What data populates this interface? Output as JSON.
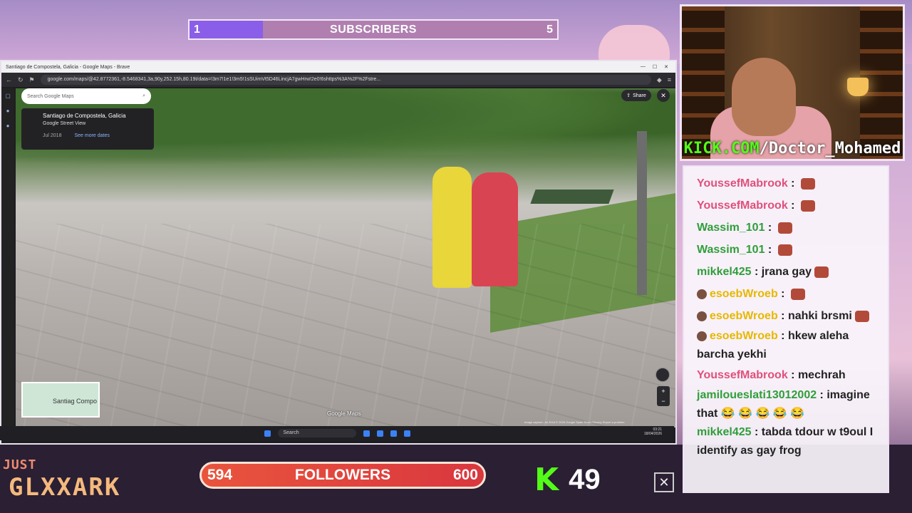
{
  "subscribers": {
    "current": "1",
    "label": "SUBSCRIBERS",
    "goal": "5",
    "progress": 0.2
  },
  "browser": {
    "tab_title": "Santiago de Compostela, Galicia - Google Maps - Brave",
    "url": "google.com/maps/@42.8772361,-8.5468341,3a,90y,252.15h,80.19t/data=!3m7!1e1!3m5!1sSUimVt5D46LincjA7gwHrw!2e0!6shttps%3A%2F%2Fstre..."
  },
  "maps": {
    "search_placeholder": "Search Google Maps",
    "place_title": "Santiago de Compostela, Galicia",
    "place_subtitle": "Google Street View",
    "date": "Jul 2018",
    "see_more": "See more dates",
    "share_label": "Share",
    "watermark": "Google Maps",
    "capture_info": "Image capture: Jul 2018  © 2026 Google  Spain  Terms  Privacy  Report a problem",
    "minimap_label": "Santiag\nCompo"
  },
  "taskbar": {
    "search": "Search",
    "time": "03:21",
    "date": "18/04/2026"
  },
  "webcam": {
    "kick_prefix": "KICK.COM",
    "kick_channel": "/Doctor_Mohamed"
  },
  "chat": [
    {
      "user": "YoussefMabrook",
      "color": "#e0507a",
      "text": "",
      "emote": true,
      "badge": false
    },
    {
      "user": "YoussefMabrook",
      "color": "#e0507a",
      "text": "",
      "emote": true,
      "badge": false
    },
    {
      "user": "Wassim_101",
      "color": "#2f9e3a",
      "text": "",
      "emote": true,
      "badge": false
    },
    {
      "user": "Wassim_101",
      "color": "#2f9e3a",
      "text": "",
      "emote": true,
      "badge": false
    },
    {
      "user": "mikkel425",
      "color": "#2f9e3a",
      "text": "jrana gay",
      "emote": true,
      "badge": false
    },
    {
      "user": "esoebWroeb",
      "color": "#e6b800",
      "text": "",
      "emote": true,
      "badge": true
    },
    {
      "user": "esoebWroeb",
      "color": "#e6b800",
      "text": "nahki brsmi",
      "emote": true,
      "badge": true
    },
    {
      "user": "esoebWroeb",
      "color": "#e6b800",
      "text": "hkew aleha barcha yekhi",
      "emote": false,
      "badge": true
    },
    {
      "user": "YoussefMabrook",
      "color": "#e0507a",
      "text": "mechrah",
      "emote": false,
      "badge": false
    },
    {
      "user": "jamiloueslati13012002",
      "color": "#2f9e3a",
      "text": "imagine that 😂 😂 😂 😂 😂",
      "emote": false,
      "badge": false
    },
    {
      "user": "mikkel425",
      "color": "#2f9e3a",
      "text": "tabda tdour w t9oul I identify as gay frog",
      "emote": false,
      "badge": false
    }
  ],
  "overlay": {
    "just_text": "JUST",
    "brand_text": "GLXXARK",
    "followers_current": "594",
    "followers_label": "FOLLOWERS",
    "followers_goal": "600",
    "kick_viewers": "49",
    "close_glyph": "✕"
  }
}
